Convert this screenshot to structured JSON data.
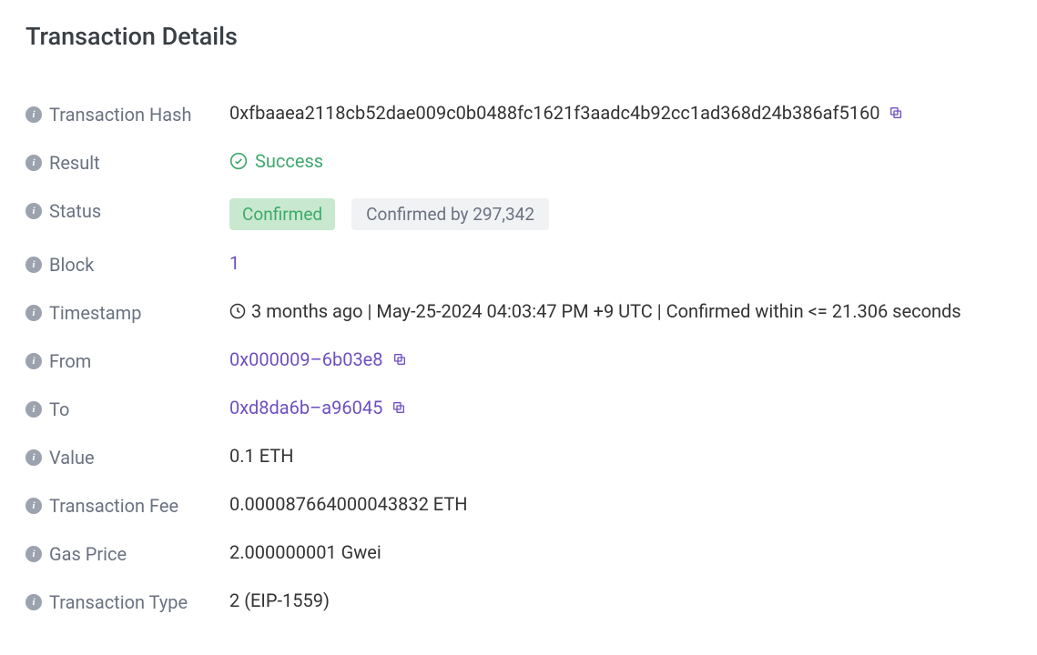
{
  "title": "Transaction Details",
  "labels": {
    "hash": "Transaction Hash",
    "result": "Result",
    "status": "Status",
    "block": "Block",
    "timestamp": "Timestamp",
    "from": "From",
    "to": "To",
    "value": "Value",
    "fee": "Transaction Fee",
    "gasPrice": "Gas Price",
    "txType": "Transaction Type"
  },
  "values": {
    "hash": "0xfbaaea2118cb52dae009c0b0488fc1621f3aadc4b92cc1ad368d24b386af5160",
    "result": "Success",
    "statusConfirmed": "Confirmed",
    "statusConfirmedBy": "Confirmed by 297,342",
    "block": "1",
    "timestamp": "3 months ago | May-25-2024 04:03:47 PM +9 UTC | Confirmed within <= 21.306 seconds",
    "from": "0x000009–6b03e8",
    "to": "0xd8da6b–a96045",
    "value": "0.1 ETH",
    "fee": "0.000087664000043832 ETH",
    "gasPrice": "2.000000001 Gwei",
    "txType": "2 (EIP-1559)"
  }
}
